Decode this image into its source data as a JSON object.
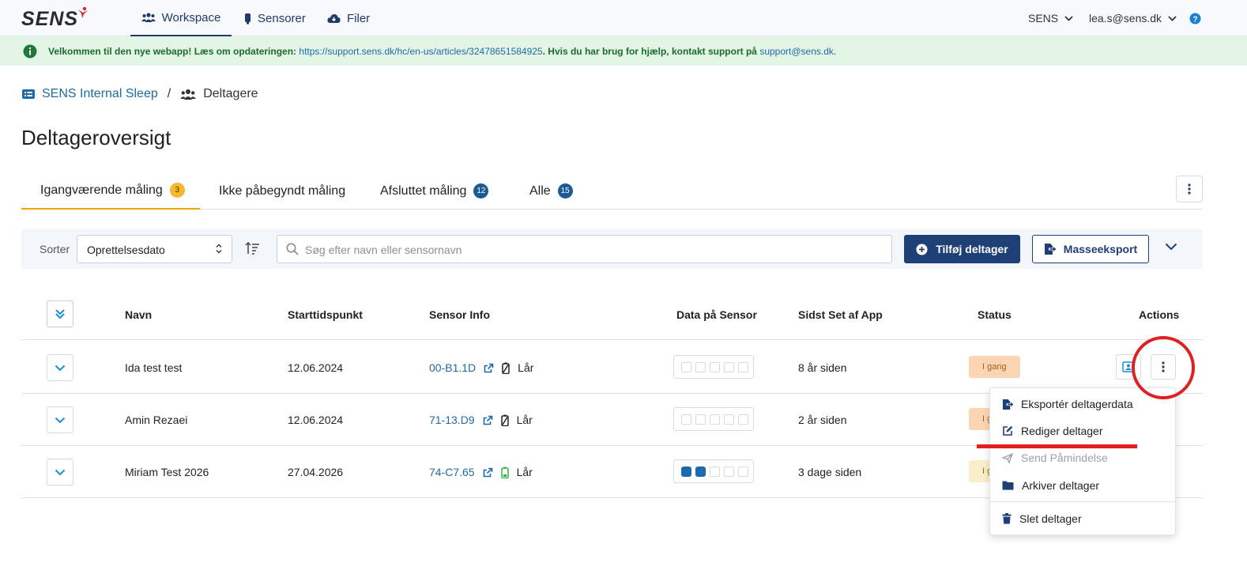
{
  "app": {
    "logo": "SENS",
    "nav": [
      {
        "label": "Workspace",
        "icon": "users-icon",
        "active": true
      },
      {
        "label": "Sensorer",
        "icon": "sensor-icon",
        "active": false
      },
      {
        "label": "Filer",
        "icon": "cloud-download-icon",
        "active": false
      }
    ],
    "org_selector": "SENS",
    "user_email": "lea.s@sens.dk"
  },
  "banner": {
    "lead": "Velkommen til den nye webapp! Læs om opdateringen:",
    "link": "https://support.sens.dk/hc/en-us/articles/32478651584925",
    "mid": ". Hvis du har brug for hjælp, kontakt support på",
    "email": "support@sens.dk",
    "end": "."
  },
  "breadcrumb": {
    "project": "SENS Internal Sleep",
    "separator": "/",
    "current": "Deltagere"
  },
  "page_title": "Deltageroversigt",
  "tabs": [
    {
      "label": "Igangværende måling",
      "count": "3",
      "active": true
    },
    {
      "label": "Ikke påbegyndt måling",
      "count": "",
      "active": false
    },
    {
      "label": "Afsluttet måling",
      "count": "12",
      "active": false
    },
    {
      "label": "Alle",
      "count": "15",
      "active": false
    }
  ],
  "toolbar": {
    "sort_label": "Sorter",
    "sort_value": "Oprettelsesdato",
    "search_placeholder": "Søg efter navn eller sensornavn",
    "add_label": "Tilføj deltager",
    "export_label": "Masseeksport"
  },
  "table": {
    "headers": {
      "name": "Navn",
      "start": "Starttidspunkt",
      "sensor": "Sensor Info",
      "data": "Data på Sensor",
      "seen": "Sidst Set af App",
      "status": "Status",
      "actions": "Actions"
    },
    "rows": [
      {
        "name": "Ida test test",
        "start": "12.06.2024",
        "sensor_id": "00-B1.1D",
        "location": "Lår",
        "battery": "empty",
        "data_filled": 0,
        "data_total": 5,
        "seen": "8 år siden",
        "status": "I gang"
      },
      {
        "name": "Amin Rezaei",
        "start": "12.06.2024",
        "sensor_id": "71-13.D9",
        "location": "Lår",
        "battery": "empty",
        "data_filled": 0,
        "data_total": 5,
        "seen": "2 år siden",
        "status": "I g"
      },
      {
        "name": "Miriam Test 2026",
        "start": "27.04.2026",
        "sensor_id": "74-C7.65",
        "location": "Lår",
        "battery": "low-green",
        "data_filled": 2,
        "data_total": 5,
        "seen": "3 dage siden",
        "status": "I g"
      }
    ]
  },
  "menu": {
    "items": [
      {
        "label": "Eksportér deltagerdata",
        "icon": "export-icon",
        "disabled": false
      },
      {
        "label": "Rediger deltager",
        "icon": "edit-icon",
        "disabled": false
      },
      {
        "label": "Send Påmindelse",
        "icon": "send-icon",
        "disabled": true
      },
      {
        "label": "Arkiver deltager",
        "icon": "folder-icon",
        "disabled": false
      },
      {
        "label": "Slet deltager",
        "icon": "trash-icon",
        "disabled": false
      }
    ]
  },
  "colors": {
    "brand_navy": "#1f3f77",
    "link_blue": "#1f6aa8",
    "tab_active": "#f0a500",
    "annotation_red": "#e02020",
    "banner_green_bg": "#e3f5e5"
  }
}
